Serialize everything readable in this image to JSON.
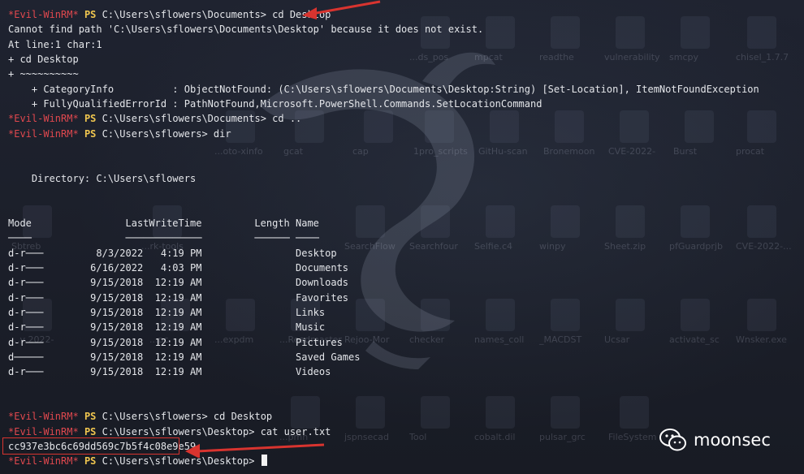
{
  "prompt": {
    "tag": "*Evil-WinRM*",
    "ps": "PS"
  },
  "lines": [
    {
      "type": "cmd",
      "path": "C:\\Users\\sflowers\\Documents>",
      "cmd": " cd Desktop"
    },
    {
      "type": "text",
      "text": "Cannot find path 'C:\\Users\\sflowers\\Documents\\Desktop' because it does not exist."
    },
    {
      "type": "text",
      "text": "At line:1 char:1"
    },
    {
      "type": "text",
      "text": "+ cd Desktop"
    },
    {
      "type": "text",
      "text": "+ ~~~~~~~~~~"
    },
    {
      "type": "text",
      "text": "    + CategoryInfo          : ObjectNotFound: (C:\\Users\\sflowers\\Documents\\Desktop:String) [Set-Location], ItemNotFoundException"
    },
    {
      "type": "text",
      "text": "    + FullyQualifiedErrorId : PathNotFound,Microsoft.PowerShell.Commands.SetLocationCommand"
    },
    {
      "type": "cmd",
      "path": "C:\\Users\\sflowers\\Documents>",
      "cmd": " cd .."
    },
    {
      "type": "cmd",
      "path": "C:\\Users\\sflowers>",
      "cmd": " dir"
    },
    {
      "type": "text",
      "text": ""
    },
    {
      "type": "text",
      "text": ""
    },
    {
      "type": "text",
      "text": "    Directory: C:\\Users\\sflowers"
    },
    {
      "type": "text",
      "text": ""
    },
    {
      "type": "text",
      "text": ""
    },
    {
      "type": "text",
      "text": "Mode                LastWriteTime         Length Name"
    },
    {
      "type": "text",
      "text": "────                ─────────────         ────── ────"
    },
    {
      "type": "text",
      "text": "d-r───         8/3/2022   4:19 PM                Desktop"
    },
    {
      "type": "text",
      "text": "d-r───        6/16/2022   4:03 PM                Documents"
    },
    {
      "type": "text",
      "text": "d-r───        9/15/2018  12:19 AM                Downloads"
    },
    {
      "type": "text",
      "text": "d-r───        9/15/2018  12:19 AM                Favorites"
    },
    {
      "type": "text",
      "text": "d-r───        9/15/2018  12:19 AM                Links"
    },
    {
      "type": "text",
      "text": "d-r───        9/15/2018  12:19 AM                Music"
    },
    {
      "type": "text",
      "text": "d-r───        9/15/2018  12:19 AM                Pictures"
    },
    {
      "type": "text",
      "text": "d─────        9/15/2018  12:19 AM                Saved Games"
    },
    {
      "type": "text",
      "text": "d-r───        9/15/2018  12:19 AM                Videos"
    },
    {
      "type": "text",
      "text": ""
    },
    {
      "type": "text",
      "text": ""
    },
    {
      "type": "cmd",
      "path": "C:\\Users\\sflowers>",
      "cmd": " cd Desktop"
    },
    {
      "type": "cmd",
      "path": "C:\\Users\\sflowers\\Desktop>",
      "cmd": " cat user.txt"
    },
    {
      "type": "text",
      "text": "cc937e3bc6c69dd569c7b5f4c08e9e59"
    },
    {
      "type": "cmd",
      "path": "C:\\Users\\sflowers\\Desktop>",
      "cmd": " ",
      "cursor": true
    }
  ],
  "desktop_icons": [
    {
      "label": "...ds_pos"
    },
    {
      "label": "mpcat"
    },
    {
      "label": "readthe"
    },
    {
      "label": "vulnerability"
    },
    {
      "label": "smcpy"
    },
    {
      "label": "chisel_1.7.7"
    },
    {
      "label": "...oto-xinfo"
    },
    {
      "label": "gcat"
    },
    {
      "label": "cap"
    },
    {
      "label": "1pro_scripts"
    },
    {
      "label": "GitHu-scan"
    },
    {
      "label": "Bronemoon"
    },
    {
      "label": "CVE-2022-"
    },
    {
      "label": "Burst"
    },
    {
      "label": "procat"
    },
    {
      "label": "Sbtreb"
    },
    {
      "label": "...rk-tools"
    },
    {
      "label": "SearchFlow"
    },
    {
      "label": "Searchfour"
    },
    {
      "label": "Selfie.c4"
    },
    {
      "label": "winpy"
    },
    {
      "label": "Sheet.zip"
    },
    {
      "label": "pfGuardprjb"
    },
    {
      "label": "CVE-2022-..."
    },
    {
      "label": "...v 2022-"
    },
    {
      "label": "...pc"
    },
    {
      "label": "...expdm"
    },
    {
      "label": "...Readmaster"
    },
    {
      "label": "Rejoo-Mor"
    },
    {
      "label": "checker"
    },
    {
      "label": "names_coll"
    },
    {
      "label": "_MACDST"
    },
    {
      "label": "Ucsar"
    },
    {
      "label": "activate_sc"
    },
    {
      "label": "Wnsker.exe"
    },
    {
      "label": "...pmn"
    },
    {
      "label": "jspnsecad"
    },
    {
      "label": "Tool"
    },
    {
      "label": "cobalt.dil"
    },
    {
      "label": "pulsar_grc"
    },
    {
      "label": "FileSystem"
    }
  ],
  "watermark": {
    "text": "moonsec",
    "logo_icon": "wechat-icon"
  },
  "colors": {
    "prompt_tag": "#e0484e",
    "prompt_ps": "#efc54f",
    "annotation": "#d8342f"
  }
}
